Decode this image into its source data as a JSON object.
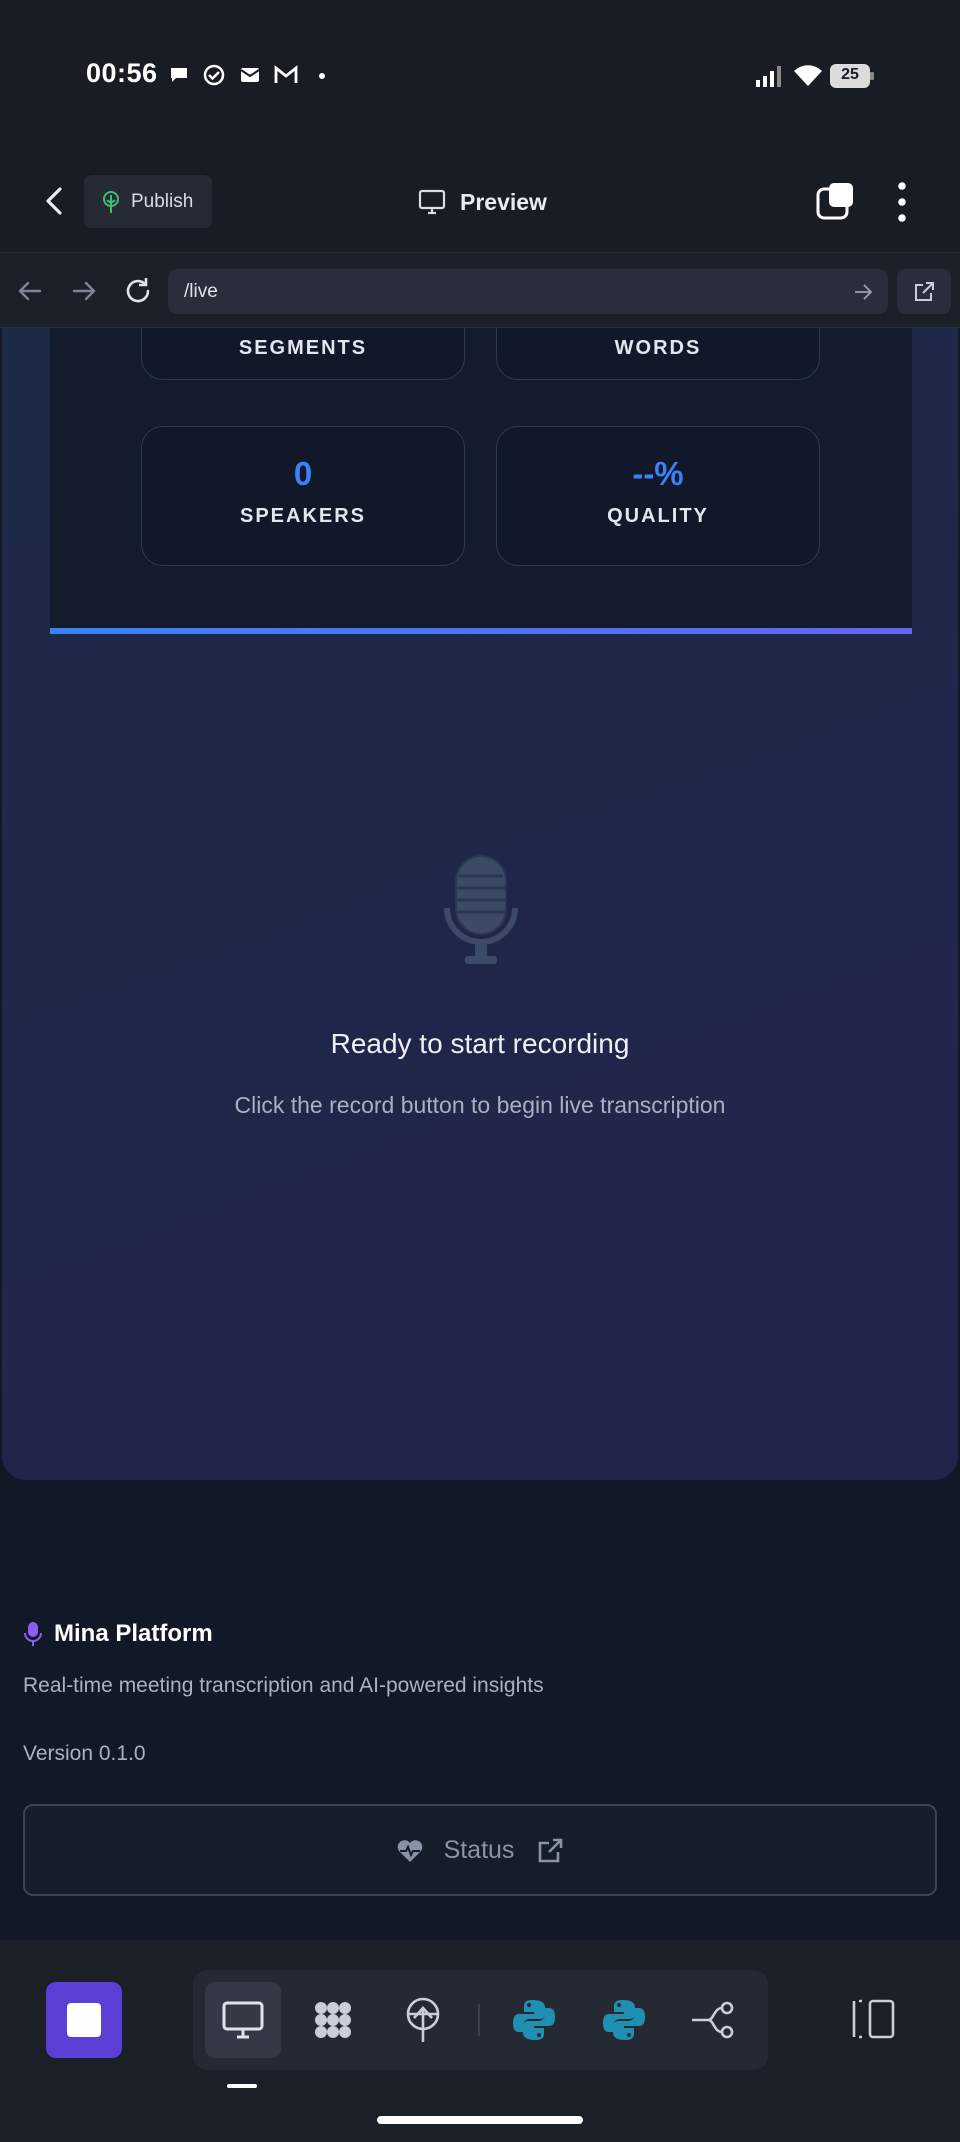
{
  "status_bar": {
    "time": "00:56",
    "battery": "25"
  },
  "header": {
    "publish_label": "Publish",
    "preview_label": "Preview"
  },
  "url_bar": {
    "url": "/live"
  },
  "stats": [
    {
      "value": "",
      "label": "SEGMENTS"
    },
    {
      "value": "",
      "label": "WORDS"
    },
    {
      "value": "0",
      "label": "SPEAKERS"
    },
    {
      "value": "--%",
      "label": "QUALITY"
    }
  ],
  "empty_state": {
    "title": "Ready to start recording",
    "subtitle": "Click the record button to begin live transcription"
  },
  "footer": {
    "brand": "Mina Platform",
    "description": "Real-time meeting transcription and AI-powered insights",
    "version": "Version 0.1.0",
    "status_label": "Status"
  },
  "colors": {
    "accent": "#3b82f6",
    "brand_purple": "#5b3fd6",
    "mic_purple": "#8b5cf6",
    "python_teal": "#1f8fb2"
  },
  "icons": [
    "back-icon",
    "tree-icon",
    "monitor-icon",
    "tabs-icon",
    "more-vertical-icon",
    "arrow-left-icon",
    "arrow-right-icon",
    "reload-icon",
    "external-link-icon",
    "microphone-icon",
    "heartbeat-icon",
    "stop-icon",
    "grid-icon",
    "python-icon",
    "flow-icon",
    "split-view-icon"
  ]
}
